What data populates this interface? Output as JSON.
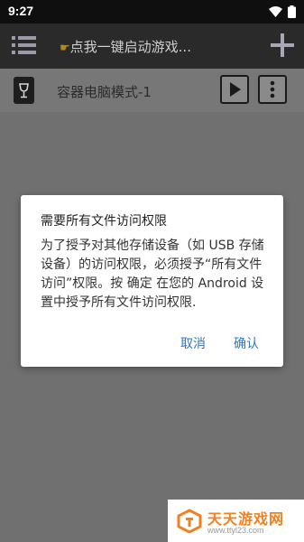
{
  "status_bar": {
    "time": "9:27"
  },
  "toolbar": {
    "title": "点我一键启动游戏...",
    "hand_glyph": "☛"
  },
  "container": {
    "name": "容器电脑模式-1"
  },
  "dialog": {
    "title": "需要所有文件访问权限",
    "message": "为了授予对其他存储设备（如 USB 存储设备）的访问权限，必须授予“所有文件访问”权限。按 确定 在您的 Android 设置中授予所有文件访问权限.",
    "cancel_label": "取消",
    "confirm_label": "确认"
  },
  "watermark": {
    "title": "天天游戏网",
    "url": "www.ttyl23.com"
  },
  "colors": {
    "accent": "#2f77c6",
    "toolbar": "#2a2a2a",
    "watermark": "#f08020"
  }
}
